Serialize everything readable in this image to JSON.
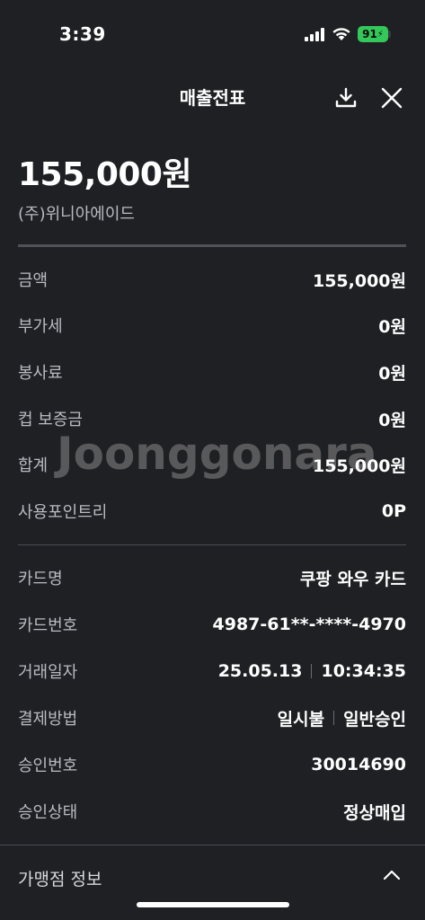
{
  "status_bar": {
    "time": "3:39",
    "battery": "91"
  },
  "header": {
    "title": "매출전표"
  },
  "summary": {
    "total_amount": "155,000원",
    "merchant": "(주)위니아에이드"
  },
  "amount_rows": [
    {
      "label": "금액",
      "value": "155,000원"
    },
    {
      "label": "부가세",
      "value": "0원"
    },
    {
      "label": "봉사료",
      "value": "0원"
    },
    {
      "label": "컵 보증금",
      "value": "0원"
    },
    {
      "label": "합계",
      "value": "155,000원"
    },
    {
      "label": "사용포인트리",
      "value": "0P"
    }
  ],
  "card_rows": {
    "card_name": {
      "label": "카드명",
      "value": "쿠팡 와우 카드"
    },
    "card_number": {
      "label": "카드번호",
      "value": "4987-61**-****-4970"
    },
    "trade_date": {
      "label": "거래일자",
      "date": "25.05.13",
      "time": "10:34:35"
    },
    "payment_method": {
      "label": "결제방법",
      "installment": "일시불",
      "approval_type": "일반승인"
    },
    "approval_number": {
      "label": "승인번호",
      "value": "30014690"
    },
    "approval_status": {
      "label": "승인상태",
      "value": "정상매입"
    }
  },
  "merchant_info": {
    "label": "가맹점 정보"
  },
  "watermark": "Joonggonara"
}
